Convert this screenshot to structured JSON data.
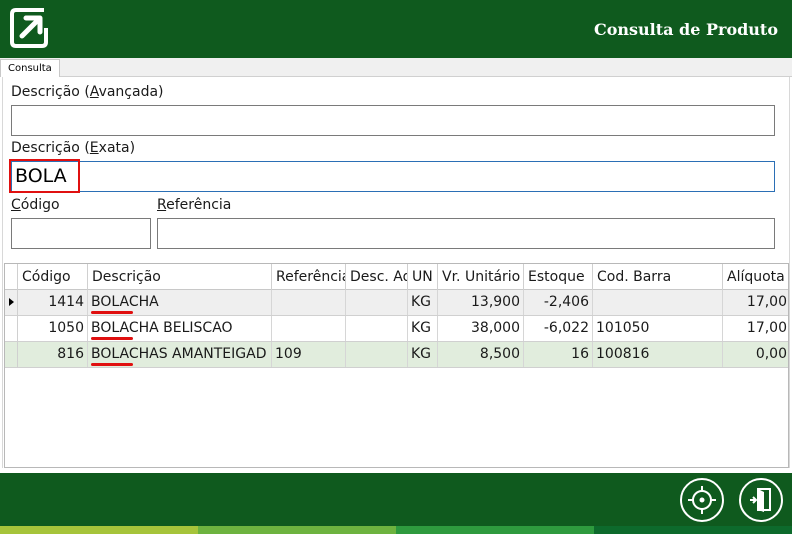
{
  "header": {
    "title": "Consulta de Produto",
    "logo_icon": "arrow-box-icon"
  },
  "tab": {
    "label": "Consulta"
  },
  "form": {
    "desc_avancada": {
      "label_pre": "Descrição (",
      "label_key": "A",
      "label_post": "vançada)",
      "value": ""
    },
    "desc_exata": {
      "label_pre": "Descrição (",
      "label_key": "E",
      "label_post": "xata)",
      "value": "BOLA"
    },
    "codigo": {
      "label_key": "C",
      "label_post": "ódigo",
      "value": ""
    },
    "referencia": {
      "label_key": "R",
      "label_post": "eferência",
      "value": ""
    }
  },
  "grid": {
    "columns": [
      "Código",
      "Descrição",
      "Referência",
      "Desc. Ad",
      "UN",
      "Vr. Unitário",
      "Estoque",
      "Cod. Barra",
      "Alíquota"
    ],
    "rows": [
      {
        "codigo": "1414",
        "descricao": "BOLACHA",
        "referencia": "",
        "desc_ad": "",
        "un": "KG",
        "vr_unitario": "13,900",
        "estoque": "-2,406",
        "cod_barra": "",
        "aliquota": "17,00"
      },
      {
        "codigo": "1050",
        "descricao": "BOLACHA BELISCAO",
        "referencia": "",
        "desc_ad": "",
        "un": "KG",
        "vr_unitario": "38,000",
        "estoque": "-6,022",
        "cod_barra": "101050",
        "aliquota": "17,00"
      },
      {
        "codigo": "816",
        "descricao": "BOLACHAS AMANTEIGAD",
        "referencia": "109",
        "desc_ad": "",
        "un": "KG",
        "vr_unitario": "8,500",
        "estoque": "16",
        "cod_barra": "100816",
        "aliquota": "0,00"
      }
    ]
  },
  "footer": {
    "buttons": [
      "target-icon",
      "exit-door-icon"
    ]
  },
  "colors": {
    "brand_green": "#0f5a1e",
    "highlight_red": "#e01010",
    "row_selected": "#e1eddd",
    "stripe_1": "#a6c43a",
    "stripe_2": "#6db33f",
    "stripe_3": "#2e9a3e",
    "stripe_4": "#0d6a2c"
  }
}
